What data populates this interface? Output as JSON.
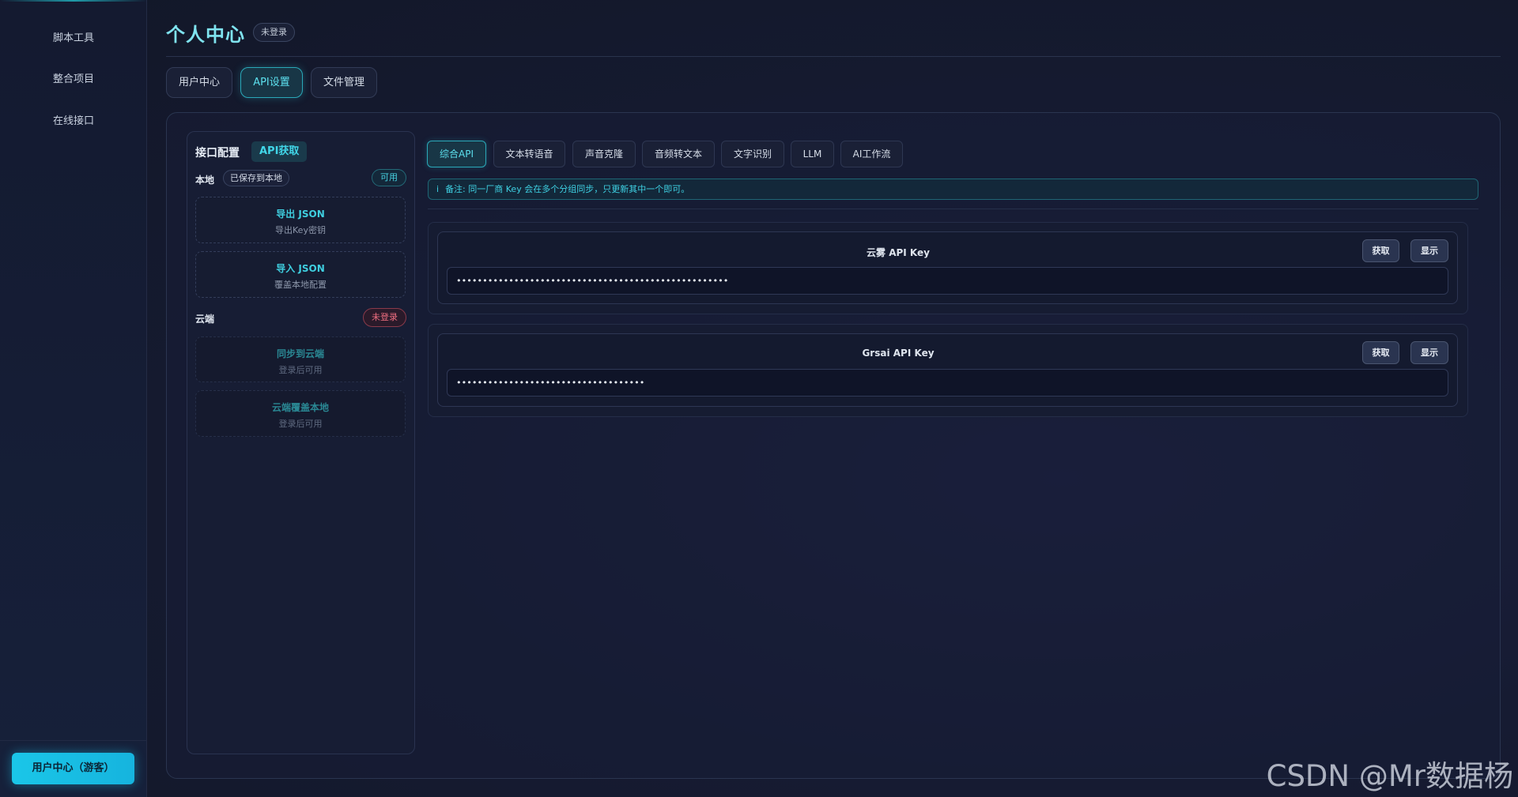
{
  "sidebar": {
    "items": [
      {
        "label": "脚本工具"
      },
      {
        "label": "整合项目"
      },
      {
        "label": "在线接口"
      }
    ],
    "user_button": "用户中心（游客）"
  },
  "header": {
    "title": "个人中心",
    "badge": "未登录"
  },
  "main_tabs": [
    {
      "label": "用户中心"
    },
    {
      "label": "API设置",
      "active": true
    },
    {
      "label": "文件管理"
    }
  ],
  "config": {
    "title": "接口配置",
    "title_badge": "API获取",
    "local": {
      "label": "本地",
      "chip": "已保存到本地",
      "status": "可用",
      "actions": [
        {
          "title": "导出 JSON",
          "sub": "导出Key密钥"
        },
        {
          "title": "导入 JSON",
          "sub": "覆盖本地配置"
        }
      ]
    },
    "cloud": {
      "label": "云端",
      "status": "未登录",
      "actions": [
        {
          "title": "同步到云端",
          "sub": "登录后可用"
        },
        {
          "title": "云端覆盖本地",
          "sub": "登录后可用"
        }
      ]
    }
  },
  "api_tabs": [
    {
      "label": "综合API",
      "active": true
    },
    {
      "label": "文本转语音"
    },
    {
      "label": "声音克隆"
    },
    {
      "label": "音频转文本"
    },
    {
      "label": "文字识别"
    },
    {
      "label": "LLM"
    },
    {
      "label": "AI工作流"
    }
  ],
  "notice": {
    "icon": "i",
    "text": "备注: 同一厂商 Key 会在多个分组同步，只更新其中一个即可。"
  },
  "keys": [
    {
      "title": "云雾 API Key",
      "fetch_label": "获取",
      "show_label": "显示",
      "value": "••••••••••••••••••••••••••••••••••••••••••••••••••••"
    },
    {
      "title": "Grsai API Key",
      "fetch_label": "获取",
      "show_label": "显示",
      "value": "••••••••••••••••••••••••••••••••••••"
    }
  ],
  "watermark": "CSDN @Mr数据杨"
}
